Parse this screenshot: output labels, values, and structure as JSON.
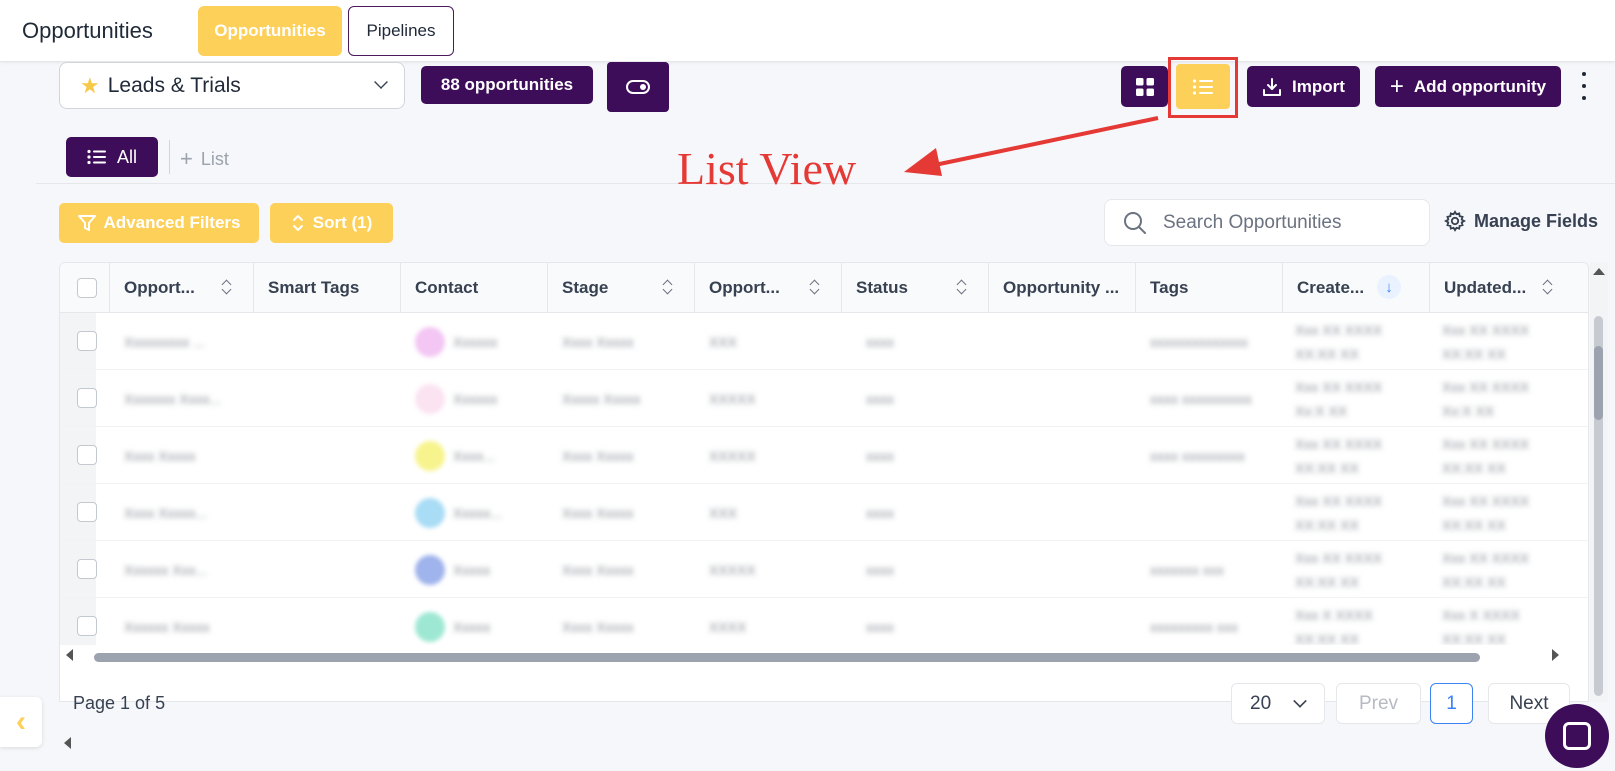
{
  "header": {
    "app_title": "Opportunities",
    "tabs": [
      {
        "label": "Opportunities",
        "active": true
      },
      {
        "label": "Pipelines",
        "active": false
      }
    ]
  },
  "toolbar": {
    "pipeline": "Leads & Trials",
    "count_label": "88 opportunities",
    "import_label": "Import",
    "add_label": "Add opportunity"
  },
  "lists": {
    "all_label": "All",
    "add_list_label": "List"
  },
  "annotation": {
    "text": "List View",
    "color": "#e53935"
  },
  "filters": {
    "advanced_label": "Advanced Filters",
    "sort_label": "Sort (1)",
    "search_placeholder": "Search Opportunities",
    "manage_fields_label": "Manage Fields"
  },
  "table": {
    "columns": [
      "Opport...",
      "Smart Tags",
      "Contact",
      "Stage",
      "Opport...",
      "Status",
      "Opportunity ...",
      "Tags",
      "Create...",
      "Updated..."
    ],
    "rows": [
      {
        "name": "Xxxxxxxxx ...",
        "contact": "Xxxxxx",
        "stage": "Xxxx Xxxxx",
        "value": "XXX",
        "status": "xxxx",
        "tags": "xxxxxxxxxxxxxx",
        "created": "Xxx XX XXXX|XX:XX XX",
        "updated": "Xxx XX XXXX|XX:XX XX",
        "avatar_color": "#f3c6f3"
      },
      {
        "name": "Xxxxxxx Xxxx...",
        "contact": "Xxxxxx",
        "stage": "Xxxxx Xxxxx",
        "value": "XXXXX",
        "status": "xxxx",
        "tags": "xxxx xxxxxxxxxx",
        "created": "Xxx XX XXXX|Xx:X XX",
        "updated": "Xxx XX XXXX|Xx:X XX",
        "avatar_color": "#fbe3f1"
      },
      {
        "name": "Xxxx Xxxxx",
        "contact": "Xxxx...",
        "stage": "Xxxx Xxxxx",
        "value": "XXXXX",
        "status": "xxxx",
        "tags": "xxxx xxxxxxxxx",
        "created": "Xxx XX XXXX|XX:XX XX",
        "updated": "Xxx XX XXXX|XX:XX XX",
        "avatar_color": "#f7f48d"
      },
      {
        "name": "Xxxx Xxxxx...",
        "contact": "Xxxxx...",
        "stage": "Xxxx Xxxxx",
        "value": "XXX",
        "status": "xxxx",
        "tags": "",
        "created": "Xxx XX XXXX|XX:XX XX",
        "updated": "Xxx XX XXXX|XX:XX XX",
        "avatar_color": "#a9dcf5"
      },
      {
        "name": "Xxxxxx Xxx...",
        "contact": "Xxxxx",
        "stage": "Xxxx Xxxxx",
        "value": "XXXXX",
        "status": "xxxx",
        "tags": "xxxxxxx   xxx",
        "created": "Xxx XX XXXX|XX:XX XX",
        "updated": "Xxx XX XXXX|XX:XX XX",
        "avatar_color": "#9fb3ec"
      },
      {
        "name": "Xxxxxx Xxxxx",
        "contact": "Xxxxx",
        "stage": "Xxxx Xxxxx",
        "value": "XXXX",
        "status": "xxxx",
        "tags": "xxxxxxxxx xxx",
        "created": "Xxx X XXXX|XX:XX XX",
        "updated": "Xxx X XXXX|XX:XX XX",
        "avatar_color": "#9ee8d3"
      }
    ]
  },
  "pagination": {
    "page_info": "Page 1 of 5",
    "per_page": "20",
    "prev_label": "Prev",
    "current_page": "1",
    "next_label": "Next"
  },
  "colors": {
    "brand_dark": "#3e0d5a",
    "brand_yellow": "#fdd05a"
  }
}
